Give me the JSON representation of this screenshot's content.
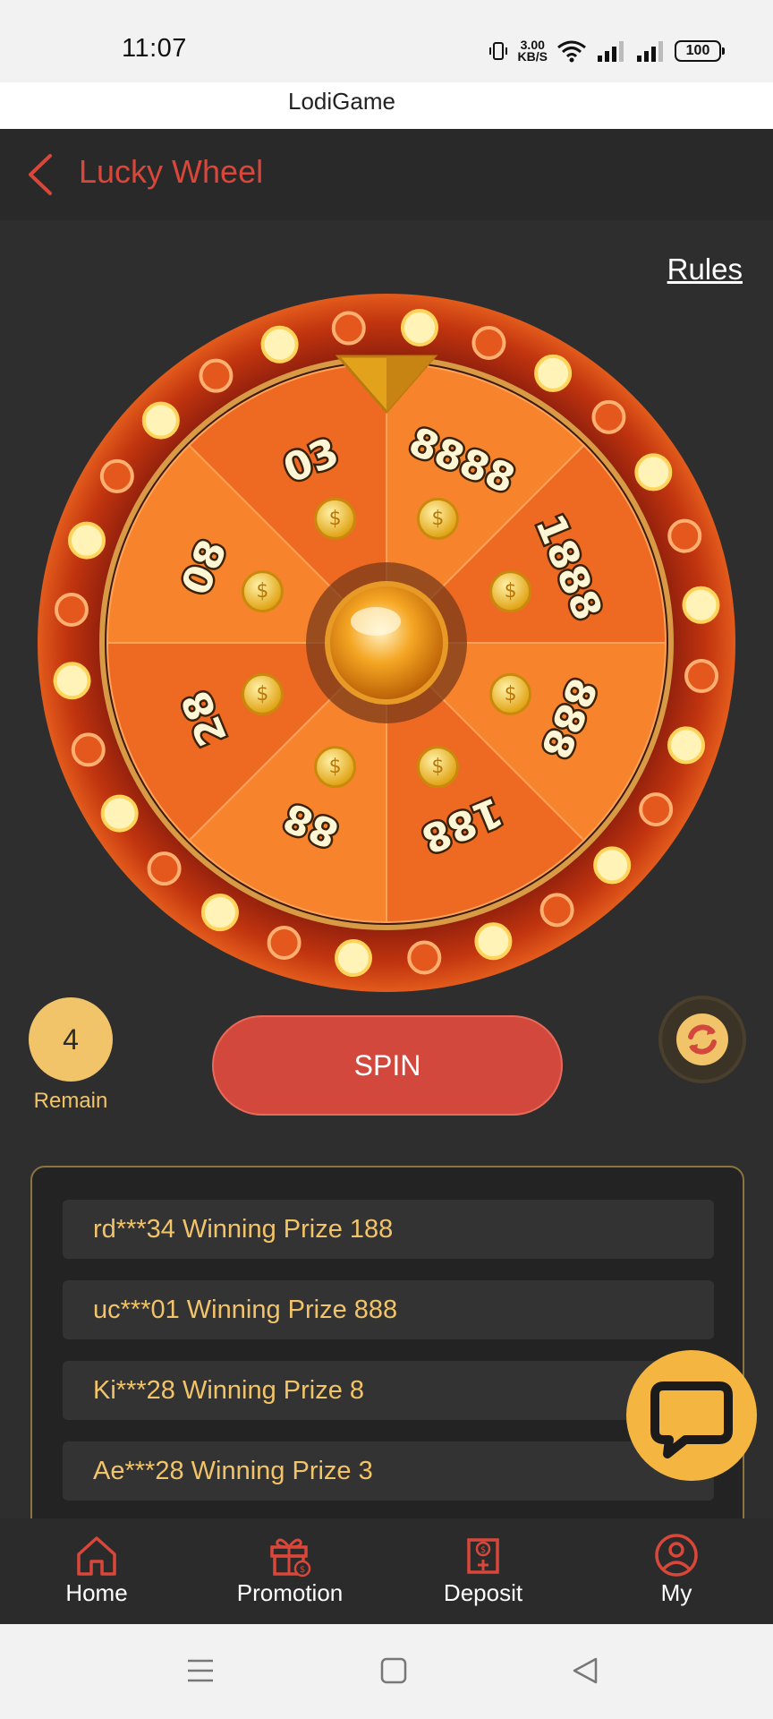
{
  "status_bar": {
    "time": "11:07",
    "net_speed_value": "3.00",
    "net_speed_unit": "KB/S",
    "battery": "100"
  },
  "app": {
    "title": "LodiGame"
  },
  "header": {
    "title": "Lucky Wheel"
  },
  "main": {
    "rules_label": "Rules",
    "wheel_prizes": [
      "8888",
      "1888",
      "888",
      "188",
      "88",
      "28",
      "08",
      "03"
    ],
    "remain_count": "4",
    "remain_label": "Remain",
    "spin_label": "SPIN"
  },
  "winners": [
    {
      "text": "rd***34 Winning Prize 188"
    },
    {
      "text": "uc***01 Winning Prize 888"
    },
    {
      "text": "Ki***28 Winning Prize 8"
    },
    {
      "text": "Ae***28 Winning Prize 3"
    }
  ],
  "bottom_nav": {
    "items": [
      {
        "label": "Home",
        "icon": "home-icon"
      },
      {
        "label": "Promotion",
        "icon": "gift-icon"
      },
      {
        "label": "Deposit",
        "icon": "deposit-icon"
      },
      {
        "label": "My",
        "icon": "user-icon"
      }
    ]
  },
  "colors": {
    "accent_red": "#d9473b",
    "gold": "#f2c46a",
    "wheel_orange": "#f27a2a",
    "chat_yellow": "#f5b541"
  }
}
